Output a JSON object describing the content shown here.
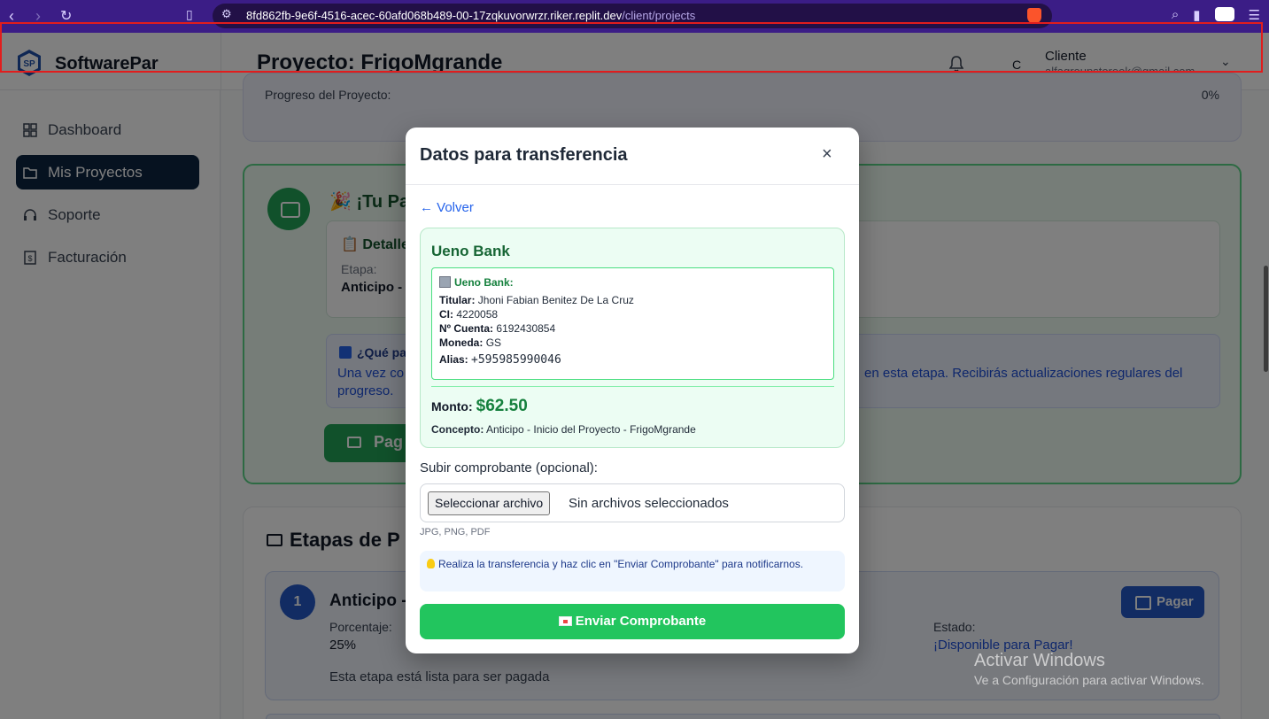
{
  "browser": {
    "url_host": "8fd862fb-9e6f-4516-acec-60afd068b489-00-17zqkuvorwrzr.riker.replit.dev",
    "url_path": "/client/projects"
  },
  "header": {
    "brand": "SoftwarePar",
    "logo_text": "SP",
    "title": "Proyecto: FrigoMgrande",
    "avatar_initial": "C",
    "user_role": "Cliente",
    "user_email": "alfagroupstoreok@gmail.com"
  },
  "sidebar": {
    "items": [
      {
        "label": "Dashboard",
        "icon": "grid-icon"
      },
      {
        "label": "Mis Proyectos",
        "icon": "folder-icon",
        "active": true
      },
      {
        "label": "Soporte",
        "icon": "headset-icon"
      },
      {
        "label": "Facturación",
        "icon": "invoice-icon"
      }
    ]
  },
  "main": {
    "progress_label": "Progreso del Proyecto:",
    "progress_value": "0%",
    "payment_title": "🎉 ¡Tu Pa",
    "detail_title": "📋 Detalle",
    "etapa_label": "Etapa:",
    "etapa_value": "Anticipo -",
    "info_title": "¿Qué pa",
    "info_text_left": "Una vez co",
    "info_text_right": "en esta etapa. Recibirás actualizaciones regulares del",
    "info_text_line2": "progreso.",
    "pay_button": "Pag",
    "stages_title": "Etapas de P",
    "stage": {
      "number": "1",
      "name": "Anticipo -",
      "percent_label": "Porcentaje:",
      "percent_value": "25%",
      "state_label": "Estado:",
      "state_value": "¡Disponible para Pagar!",
      "ready_text": "Esta etapa está lista para ser pagada",
      "pay_button": "Pagar"
    }
  },
  "modal": {
    "title": "Datos para transferencia",
    "close": "×",
    "back_link": "← Volver",
    "bank_name": "Ueno Bank",
    "bank_inner_title": "Ueno Bank:",
    "titular_label": "Titular:",
    "titular_value": "Jhoni Fabian Benitez De La Cruz",
    "ci_label": "CI:",
    "ci_value": "4220058",
    "cuenta_label": "Nº Cuenta:",
    "cuenta_value": "6192430854",
    "moneda_label": "Moneda:",
    "moneda_value": "GS",
    "alias_label": "Alias:",
    "alias_value": "+595985990046",
    "monto_label": "Monto:",
    "monto_value": "$62.50",
    "concepto_label": "Concepto:",
    "concepto_value": "Anticipo - Inicio del Proyecto - FrigoMgrande",
    "upload_label": "Subir comprobante (opcional):",
    "file_button": "Seleccionar archivo",
    "file_status": "Sin archivos seleccionados",
    "file_hint": "JPG, PNG, PDF",
    "tip": "Realiza la transferencia y haz clic en \"Enviar Comprobante\" para notificarnos.",
    "send_button": "Enviar Comprobante"
  },
  "watermark": {
    "title": "Activar Windows",
    "subtitle": "Ve a Configuración para activar Windows."
  }
}
